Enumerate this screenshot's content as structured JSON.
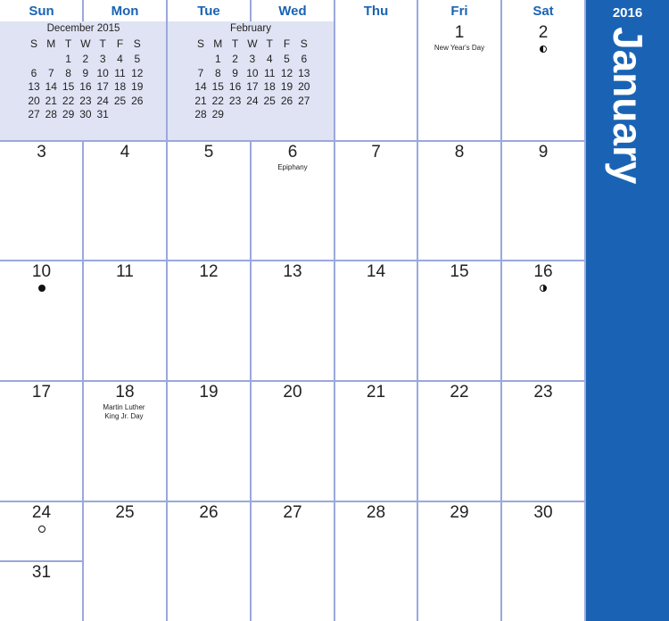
{
  "year": "2016",
  "month": "January",
  "weekdays": [
    "Sun",
    "Mon",
    "Tue",
    "Wed",
    "Thu",
    "Fri",
    "Sat"
  ],
  "mini_calendars": [
    {
      "title": "December 2015",
      "weekdays": [
        "S",
        "M",
        "T",
        "W",
        "T",
        "F",
        "S"
      ],
      "rows": [
        [
          "",
          "",
          "1",
          "2",
          "3",
          "4",
          "5"
        ],
        [
          "6",
          "7",
          "8",
          "9",
          "10",
          "11",
          "12"
        ],
        [
          "13",
          "14",
          "15",
          "16",
          "17",
          "18",
          "19"
        ],
        [
          "20",
          "21",
          "22",
          "23",
          "24",
          "25",
          "26"
        ],
        [
          "27",
          "28",
          "29",
          "30",
          "31",
          "",
          ""
        ]
      ]
    },
    {
      "title": "February",
      "weekdays": [
        "S",
        "M",
        "T",
        "W",
        "T",
        "F",
        "S"
      ],
      "rows": [
        [
          "",
          "1",
          "2",
          "3",
          "4",
          "5",
          "6"
        ],
        [
          "7",
          "8",
          "9",
          "10",
          "11",
          "12",
          "13"
        ],
        [
          "14",
          "15",
          "16",
          "17",
          "18",
          "19",
          "20"
        ],
        [
          "21",
          "22",
          "23",
          "24",
          "25",
          "26",
          "27"
        ],
        [
          "28",
          "29",
          "",
          "",
          "",
          "",
          ""
        ]
      ]
    }
  ],
  "days": [
    {
      "day": "1",
      "col": 5,
      "row": 0,
      "note": "New Year's Day"
    },
    {
      "day": "2",
      "col": 6,
      "row": 0,
      "moon": "moon-lq"
    },
    {
      "day": "3",
      "col": 0,
      "row": 1
    },
    {
      "day": "4",
      "col": 1,
      "row": 1
    },
    {
      "day": "5",
      "col": 2,
      "row": 1
    },
    {
      "day": "6",
      "col": 3,
      "row": 1,
      "note": "Epiphany"
    },
    {
      "day": "7",
      "col": 4,
      "row": 1
    },
    {
      "day": "8",
      "col": 5,
      "row": 1
    },
    {
      "day": "9",
      "col": 6,
      "row": 1
    },
    {
      "day": "10",
      "col": 0,
      "row": 2,
      "moon": "moon-new"
    },
    {
      "day": "11",
      "col": 1,
      "row": 2
    },
    {
      "day": "12",
      "col": 2,
      "row": 2
    },
    {
      "day": "13",
      "col": 3,
      "row": 2
    },
    {
      "day": "14",
      "col": 4,
      "row": 2
    },
    {
      "day": "15",
      "col": 5,
      "row": 2
    },
    {
      "day": "16",
      "col": 6,
      "row": 2,
      "moon": "moon-fq"
    },
    {
      "day": "17",
      "col": 0,
      "row": 3
    },
    {
      "day": "18",
      "col": 1,
      "row": 3,
      "note": "Martin Luther King Jr. Day"
    },
    {
      "day": "19",
      "col": 2,
      "row": 3
    },
    {
      "day": "20",
      "col": 3,
      "row": 3
    },
    {
      "day": "21",
      "col": 4,
      "row": 3
    },
    {
      "day": "22",
      "col": 5,
      "row": 3
    },
    {
      "day": "23",
      "col": 6,
      "row": 3
    },
    {
      "day": "24",
      "col": 0,
      "row": 4,
      "moon": "moon-full"
    },
    {
      "day": "25",
      "col": 1,
      "row": 4
    },
    {
      "day": "26",
      "col": 2,
      "row": 4
    },
    {
      "day": "27",
      "col": 3,
      "row": 4
    },
    {
      "day": "28",
      "col": 4,
      "row": 4
    },
    {
      "day": "29",
      "col": 5,
      "row": 4
    },
    {
      "day": "30",
      "col": 6,
      "row": 4
    },
    {
      "day": "31",
      "col": 0,
      "row": 5
    }
  ]
}
